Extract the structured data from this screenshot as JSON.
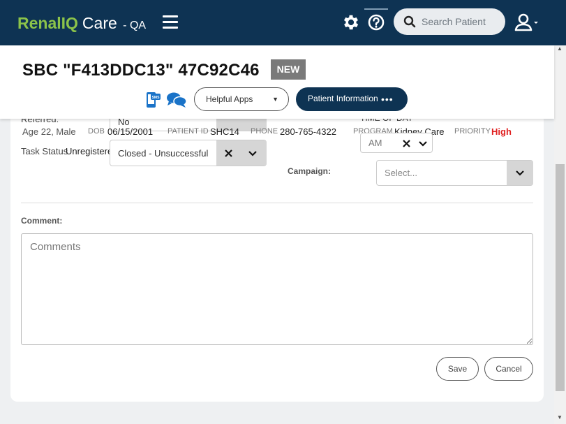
{
  "app": {
    "brand_part1": "Renal",
    "brand_part2": "IQ",
    "brand_part3": "Care",
    "env": "- QA"
  },
  "search": {
    "placeholder": "Search Patient"
  },
  "patient": {
    "title": "SBC \"F413DDC13\" 47C92C46",
    "badge": "NEW",
    "age_sex": "Age 22, Male",
    "dob_label": "DOB",
    "dob": "06/15/2001",
    "patient_id_label": "PATIENT ID",
    "patient_id": "SHC14",
    "phone_label": "PHONE",
    "phone": "280-765-4322",
    "program_label": "PROGRAM",
    "program": "Kidney Care",
    "priority_label": "PRIORITY",
    "priority": "High",
    "status": "Unregistered"
  },
  "toolbar": {
    "helpful_apps": "Helpful Apps",
    "patient_info": "Patient Information",
    "more": "•••"
  },
  "form": {
    "referred_label": "Referred:",
    "referred_value": "No",
    "time_of_day_label": "TIME OF DAY",
    "time_of_day_value": "AM",
    "task_status_label": "Task Status",
    "task_status_value": "Closed - Unsuccessful",
    "campaign_label": "Campaign:",
    "campaign_placeholder": "Select...",
    "comment_label": "Comment:",
    "comment_placeholder": "Comments",
    "save": "Save",
    "cancel": "Cancel"
  },
  "colors": {
    "navy": "#0e3353",
    "brand_green": "#8bc34a",
    "priority_red": "#e02020"
  }
}
